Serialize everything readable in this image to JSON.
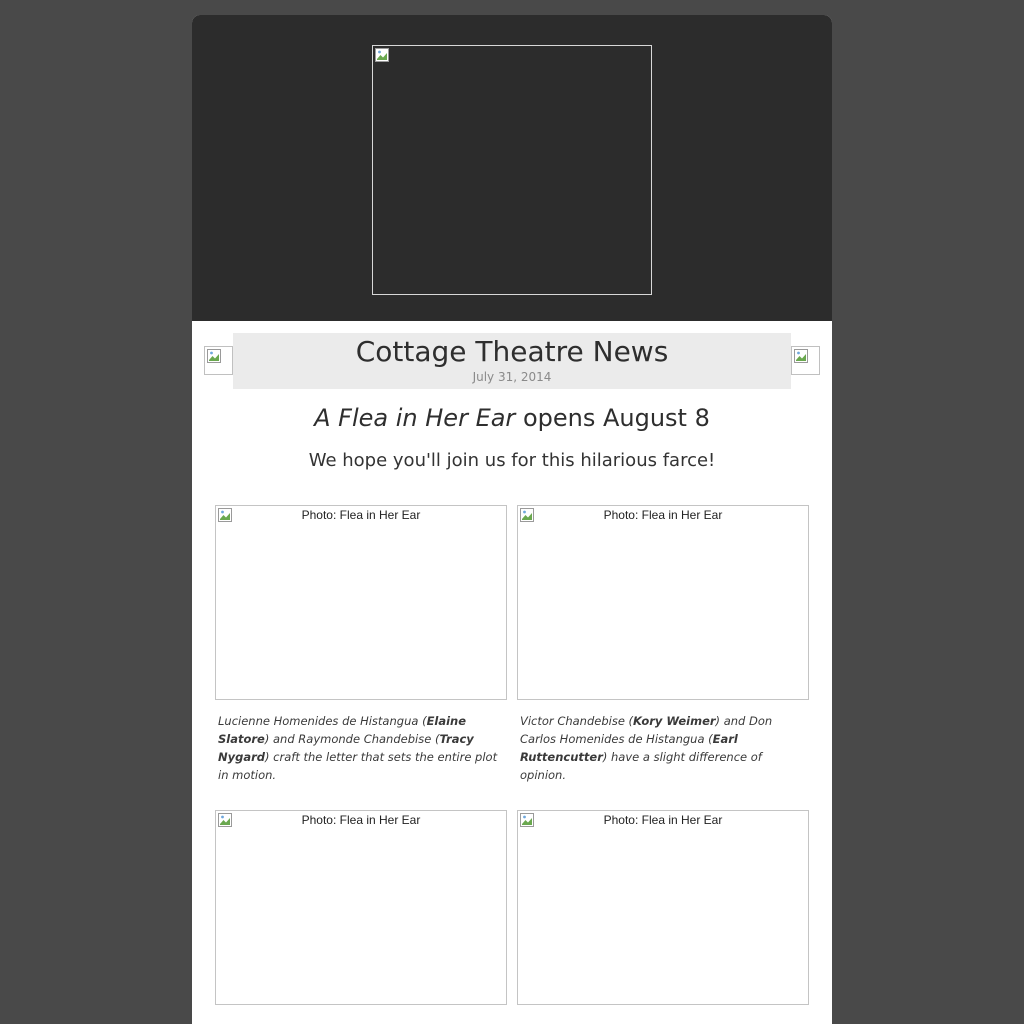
{
  "newsletter": {
    "title": "Cottage Theatre News",
    "date": "July 31, 2014"
  },
  "headline": {
    "show_title": "A Flea in Her Ear",
    "suffix": " opens August 8"
  },
  "subheadline": "We hope you'll join us for this hilarious farce!",
  "photos": [
    {
      "alt": "Photo: Flea in Her Ear",
      "caption": [
        {
          "text": "Lucienne Homenides de Histangua ("
        },
        {
          "text": "Elaine Slatore",
          "bold": true
        },
        {
          "text": ") and Raymonde Chandebise ("
        },
        {
          "text": "Tracy Nygard",
          "bold": true
        },
        {
          "text": ") craft the letter that sets the entire plot in motion."
        }
      ]
    },
    {
      "alt": "Photo: Flea in Her Ear",
      "caption": [
        {
          "text": "Victor Chandebise ("
        },
        {
          "text": "Kory Weimer",
          "bold": true
        },
        {
          "text": ") and Don Carlos Homenides de Histangua ("
        },
        {
          "text": "Earl Ruttencutter",
          "bold": true
        },
        {
          "text": ") have a slight difference of opinion."
        }
      ]
    },
    {
      "alt": "Photo: Flea in Her Ear",
      "caption": []
    },
    {
      "alt": "Photo: Flea in Her Ear",
      "caption": []
    }
  ],
  "colors": {
    "background": "#494949",
    "header": "#2c2c2c",
    "title_band": "#ebebeb",
    "text": "#2e2e2e"
  },
  "icons": {
    "logo": "broken-image-icon",
    "side_left": "broken-image-icon",
    "side_right": "broken-image-icon"
  }
}
